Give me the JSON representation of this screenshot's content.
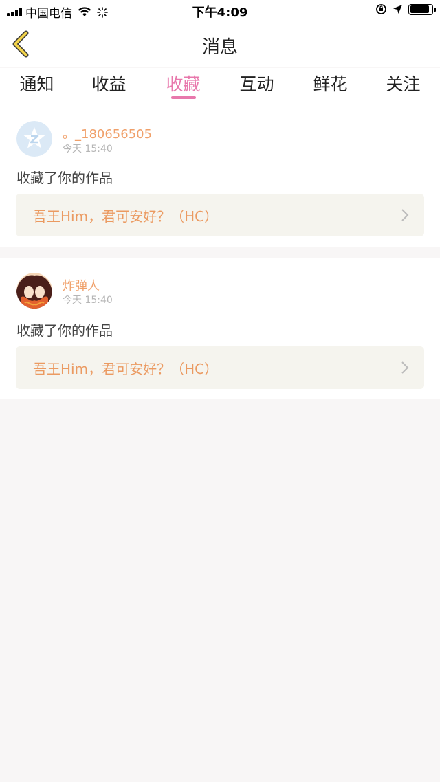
{
  "status_bar": {
    "carrier": "中国电信",
    "time": "下午4:09",
    "battery_level": 0.9
  },
  "nav": {
    "title": "消息",
    "back_icon": "chevron-left-icon"
  },
  "tabs": [
    {
      "label": "通知",
      "active": false
    },
    {
      "label": "收益",
      "active": false
    },
    {
      "label": "收藏",
      "active": true
    },
    {
      "label": "互动",
      "active": false
    },
    {
      "label": "鲜花",
      "active": false
    },
    {
      "label": "关注",
      "active": false
    }
  ],
  "messages": [
    {
      "username": "。_180656505",
      "time": "今天 15:40",
      "action": "收藏了你的作品",
      "work_title": "吾王Him，君可安好？（HC）",
      "avatar": "default-qq-avatar"
    },
    {
      "username": "炸弹人",
      "time": "今天 15:40",
      "action": "收藏了你的作品",
      "work_title": "吾王Him，君可安好？（HC）",
      "avatar": "anime-avatar"
    }
  ],
  "colors": {
    "accent": "#e878ac",
    "username": "#f0a06a",
    "work_title": "#eb9a61",
    "back_arrow": "#f2d34a"
  }
}
